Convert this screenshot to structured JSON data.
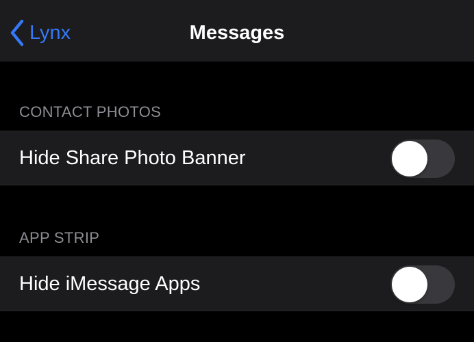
{
  "nav": {
    "back_label": "Lynx",
    "title": "Messages",
    "back_icon": "chevron-left-icon",
    "accent_color": "#3478f6"
  },
  "sections": [
    {
      "header": "CONTACT PHOTOS",
      "rows": [
        {
          "label": "Hide Share Photo Banner",
          "toggle_on": false
        }
      ]
    },
    {
      "header": "APP STRIP",
      "rows": [
        {
          "label": "Hide iMessage Apps",
          "toggle_on": false
        }
      ]
    }
  ],
  "colors": {
    "background": "#000000",
    "cell_background": "#1c1c1e",
    "toggle_off": "#39393d",
    "section_header_text": "#8d8d93"
  }
}
